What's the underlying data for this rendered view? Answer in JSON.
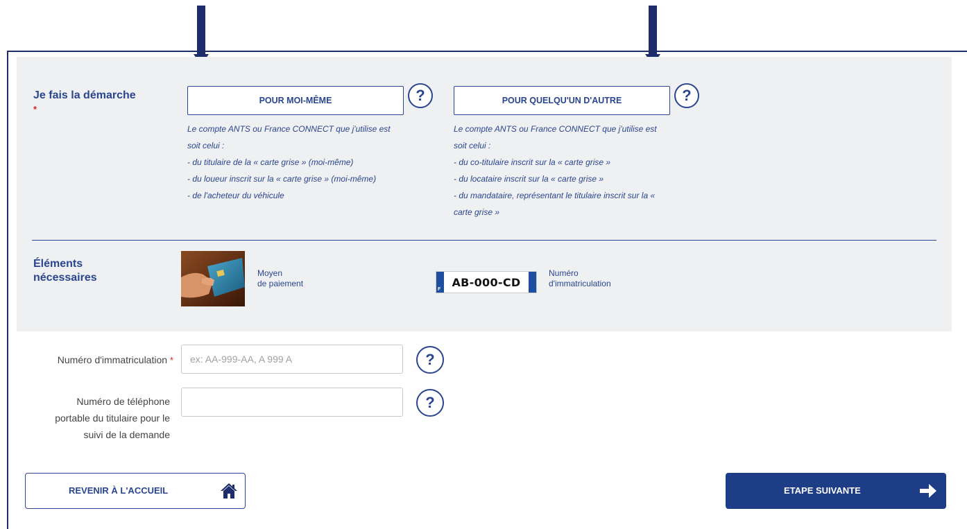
{
  "demarche": {
    "label": "Je fais la démarche",
    "required_marker": "*",
    "options": [
      {
        "button_label": "POUR MOI-MÊME",
        "help_icon": "question-mark-icon",
        "description": [
          "Le compte ANTS ou France CONNECT que j'utilise est",
          "soit celui :",
          "- du titulaire de la « carte grise » (moi-même)",
          "- du loueur inscrit sur la « carte grise » (moi-même)",
          "- de l'acheteur du véhicule"
        ]
      },
      {
        "button_label": "POUR QUELQU'UN D'AUTRE",
        "help_icon": "question-mark-icon",
        "description": [
          "Le compte ANTS ou France CONNECT que j'utilise est",
          "soit celui :",
          "- du co-titulaire inscrit sur la « carte grise »",
          "- du locataire inscrit sur la « carte grise »",
          "- du mandataire, représentant le titulaire inscrit sur la «",
          "carte grise »"
        ]
      }
    ]
  },
  "elements": {
    "label_line1": "Éléments",
    "label_line2": "nécessaires",
    "payment_line1": "Moyen",
    "payment_line2": "de paiement",
    "plate_text": "AB-000-CD",
    "plate_country": "F",
    "plate_caption_line1": "Numéro",
    "plate_caption_line2": "d'immatriculation"
  },
  "form": {
    "immat_label": "Numéro d'immatriculation",
    "immat_required": "*",
    "immat_placeholder": "ex: AA-999-AA, A 999 A",
    "immat_value": "",
    "phone_label_line1": "Numéro de téléphone",
    "phone_label_line2": "portable du titulaire pour le",
    "phone_label_line3": "suivi de la demande",
    "phone_value": "",
    "help_glyph": "?"
  },
  "actions": {
    "back_label": "REVENIR À L'ACCUEIL",
    "back_icon": "home-icon",
    "next_label": "ETAPE SUIVANTE",
    "next_icon": "arrow-right-icon"
  },
  "colors": {
    "brand_blue": "#2a4590",
    "dark_navy": "#1d2d6b",
    "primary_button": "#1d3e87",
    "panel_gray": "#eef0f1",
    "required_red": "#d9232e"
  }
}
